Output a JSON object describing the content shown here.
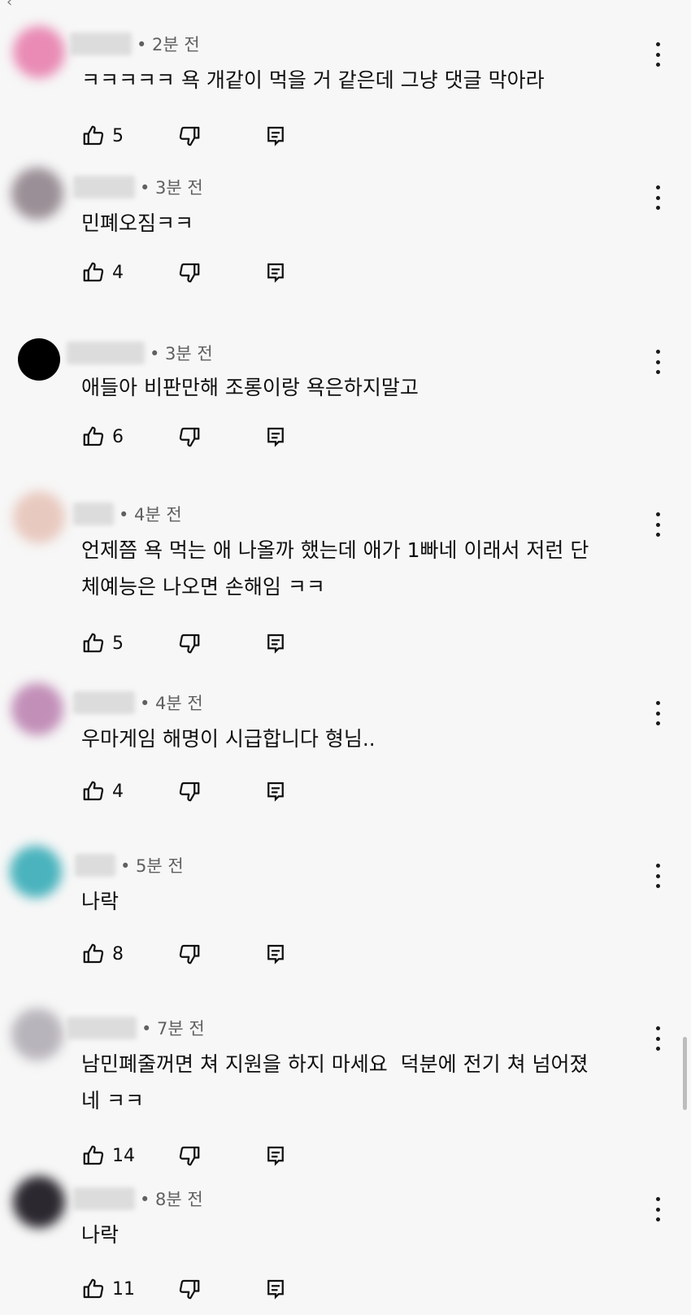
{
  "comments": [
    {
      "time": "• 2분 전",
      "text": "ㅋㅋㅋㅋㅋ 욕 개같이 먹을 거 같은데 그냥 댓글 막아라",
      "likes": "5",
      "avatar_color": "#e98bb5"
    },
    {
      "time": "• 3분 전",
      "text": "민폐오짐ㅋㅋ",
      "likes": "4",
      "avatar_color": "#9a8f96"
    },
    {
      "time": "• 3분 전",
      "text": "애들아 비판만해 조롱이랑 욕은하지말고",
      "likes": "6",
      "avatar_color": "#000000"
    },
    {
      "time": "• 4분 전",
      "text": "언제쯤 욕 먹는 애 나올까 했는데 애가 1빠네 이래서 저런 단\n체예능은 나오면 손해임 ㅋㅋ",
      "likes": "5",
      "avatar_color": "#e8c9bf"
    },
    {
      "time": "• 4분 전",
      "text": "우마게임 해명이 시급합니다 형님..",
      "likes": "4",
      "avatar_color": "#c28fb8"
    },
    {
      "time": "• 5분 전",
      "text": "나락",
      "likes": "8",
      "avatar_color": "#4ab3bd"
    },
    {
      "time": "• 7분 전",
      "text": "남민폐줄꺼면 쳐 지원을 하지 마세요  덕분에 전기 쳐 넘어졌\n네 ㅋㅋ",
      "likes": "14",
      "avatar_color": "#b8b4bb"
    },
    {
      "time": "• 8분 전",
      "text": "나락",
      "likes": "11",
      "avatar_color": "#2c2830"
    }
  ],
  "icons": {
    "like": "thumbs-up-icon",
    "dislike": "thumbs-down-icon",
    "reply": "reply-icon",
    "more": "more-vert-icon"
  }
}
